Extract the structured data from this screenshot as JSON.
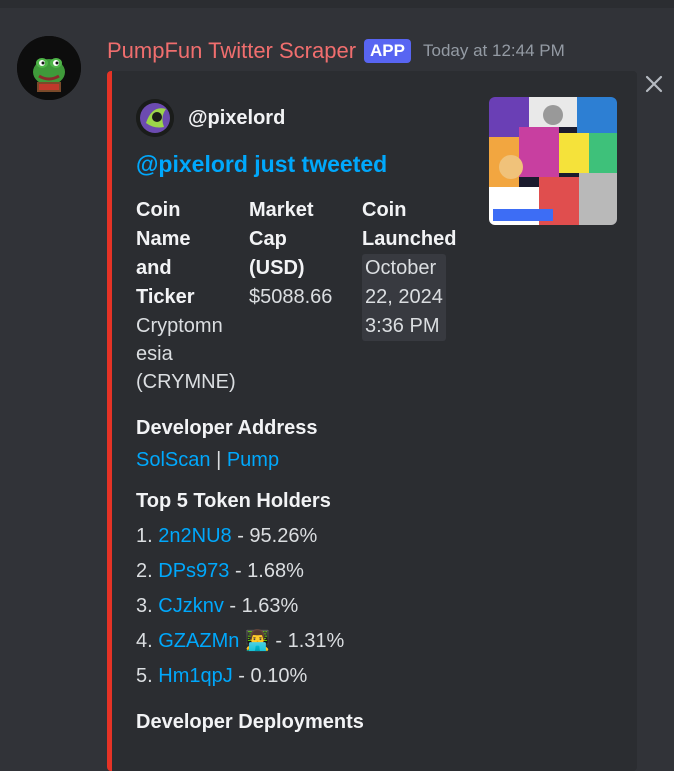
{
  "message": {
    "author": "PumpFun Twitter Scraper",
    "badge": "APP",
    "timestamp": "Today at 12:44 PM"
  },
  "embed": {
    "accent_color": "#e53326",
    "author_name": "@pixelord",
    "title": "@pixelord just tweeted",
    "fields": {
      "coin_name": {
        "name_lines": [
          "Coin",
          "Name",
          "and",
          "Ticker"
        ],
        "value_lines": [
          "Cryptomn",
          "esia",
          "(CRYMNE)"
        ]
      },
      "market_cap": {
        "name_lines": [
          "Market",
          "Cap",
          "(USD)"
        ],
        "value": "$5088.66"
      },
      "launched": {
        "name_lines": [
          "Coin",
          "Launched"
        ],
        "value_lines": [
          "October",
          "22, 2024",
          "3:36 PM"
        ]
      },
      "developer_address": {
        "name": "Developer Address",
        "solscan": "SolScan",
        "separator": "|",
        "pump": "Pump"
      },
      "top_holders": {
        "name": "Top 5 Token Holders",
        "items": [
          {
            "num": "1.",
            "addr": "2n2NU8",
            "pct": "- 95.26%"
          },
          {
            "num": "2.",
            "addr": "DPs973",
            "pct": "- 1.68%"
          },
          {
            "num": "3.",
            "addr": "CJzknv",
            "pct": "- 1.63%"
          },
          {
            "num": "4.",
            "addr": "GZAZMn",
            "pct": "- 1.31%",
            "emoji": "👨‍💻"
          },
          {
            "num": "5.",
            "addr": "Hm1qpJ",
            "pct": "- 0.10%"
          }
        ]
      },
      "developer_deployments": {
        "name": "Developer Deployments"
      }
    }
  }
}
